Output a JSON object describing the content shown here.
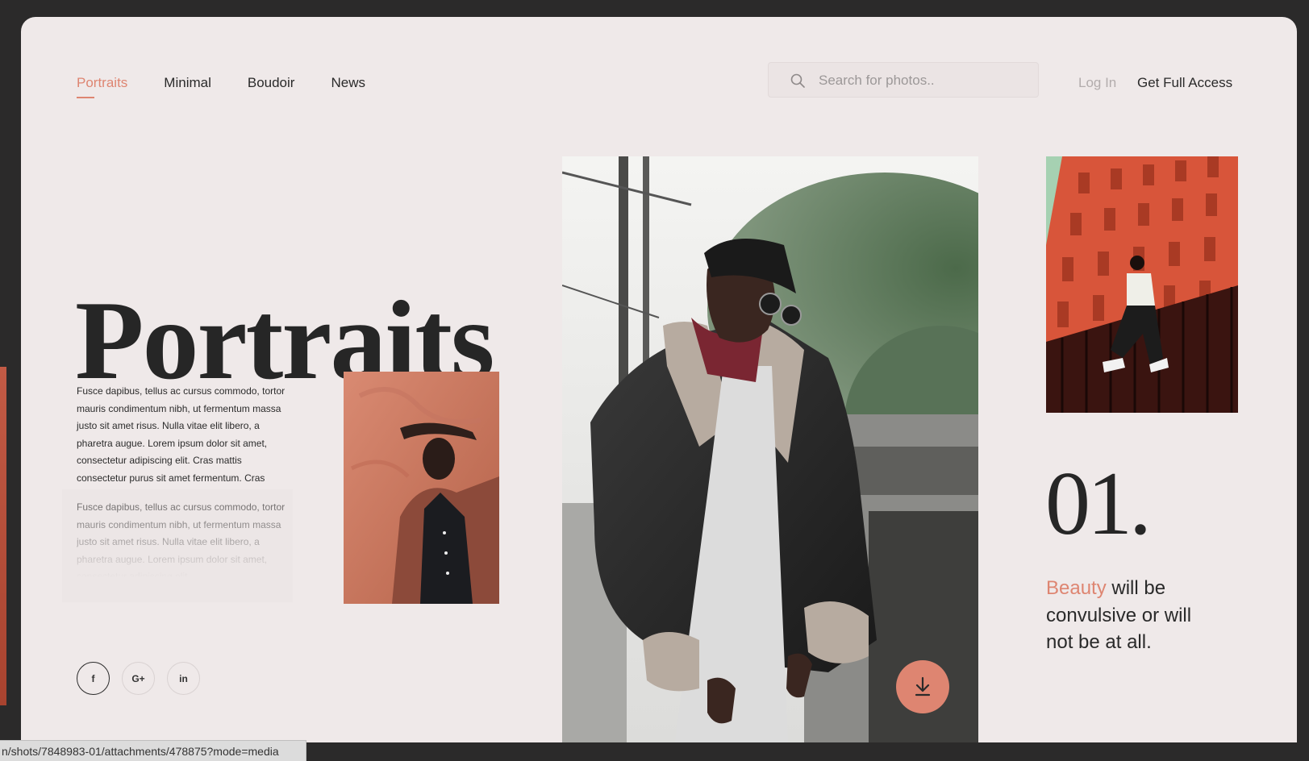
{
  "nav": {
    "items": [
      {
        "label": "Portraits",
        "active": true
      },
      {
        "label": "Minimal",
        "active": false
      },
      {
        "label": "Boudoir",
        "active": false
      },
      {
        "label": "News",
        "active": false
      }
    ]
  },
  "search": {
    "placeholder": "Search for photos..",
    "icon": "search-icon"
  },
  "header": {
    "login_label": "Log In",
    "access_label": "Get Full Access"
  },
  "hero": {
    "title": "Portraits"
  },
  "body": {
    "paragraph1": "Fusce dapibus, tellus ac cursus commodo, tortor mauris condimentum nibh, ut fermentum massa justo sit amet risus. Nulla vitae elit libero, a pharetra augue. Lorem ipsum dolor sit amet, consectetur adipiscing elit. Cras mattis consectetur purus sit amet fermentum. Cras mattis consectetur.",
    "paragraph2": "Fusce dapibus, tellus ac cursus commodo, tortor mauris condimentum nibh, ut fermentum massa justo sit amet risus. Nulla vitae elit libero, a pharetra augue. Lorem ipsum dolor sit amet, consectetur adipiscing elit."
  },
  "feature": {
    "number": "01.",
    "quote_accent": "Beauty",
    "quote_rest": " will be convulsive or will not be at all."
  },
  "socials": [
    {
      "label": "f",
      "icon": "facebook-icon"
    },
    {
      "label": "G+",
      "icon": "google-plus-icon"
    },
    {
      "label": "in",
      "icon": "linkedin-icon"
    }
  ],
  "download": {
    "icon": "download-icon"
  },
  "status_bar": {
    "url": "n/shots/7848983-01/attachments/478875?mode=media"
  },
  "colors": {
    "accent": "#de8571",
    "background": "#efe9e9",
    "text": "#262626",
    "frame": "#2b2a2a"
  }
}
